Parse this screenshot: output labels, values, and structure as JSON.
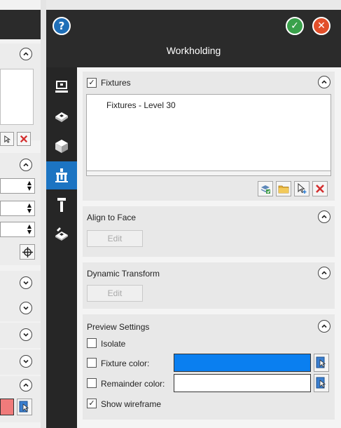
{
  "dialog": {
    "title": "Workholding",
    "help_icon": "?",
    "ok_icon": "✓",
    "cancel_icon": "✕"
  },
  "sidebar": {
    "tabs": [
      {
        "icon": "fixture-base-icon",
        "active": false
      },
      {
        "icon": "stock-shape-icon",
        "active": false
      },
      {
        "icon": "box-icon",
        "active": false
      },
      {
        "icon": "workholding-icon",
        "active": true
      },
      {
        "icon": "tool-icon",
        "active": false
      },
      {
        "icon": "part-setup-icon",
        "active": false
      }
    ]
  },
  "fixtures": {
    "label": "Fixtures",
    "checked": true,
    "items": [
      "Fixtures - Level 30"
    ]
  },
  "align_to_face": {
    "label": "Align to Face",
    "edit_label": "Edit"
  },
  "dynamic_transform": {
    "label": "Dynamic Transform",
    "edit_label": "Edit"
  },
  "preview": {
    "label": "Preview Settings",
    "isolate_label": "Isolate",
    "isolate_checked": false,
    "fixture_color_label": "Fixture color:",
    "fixture_color_checked": false,
    "fixture_color": "#0a7ff0",
    "remainder_color_label": "Remainder color:",
    "remainder_color_checked": false,
    "remainder_color": "#ffffff",
    "wireframe_label": "Show wireframe",
    "wireframe_checked": true
  },
  "left_panel": {
    "swatch_color": "#f07b7b"
  },
  "colors": {
    "header_bg": "#2b2b2b",
    "tab_active": "#1c74c2",
    "delete_red": "#d32f2f"
  }
}
